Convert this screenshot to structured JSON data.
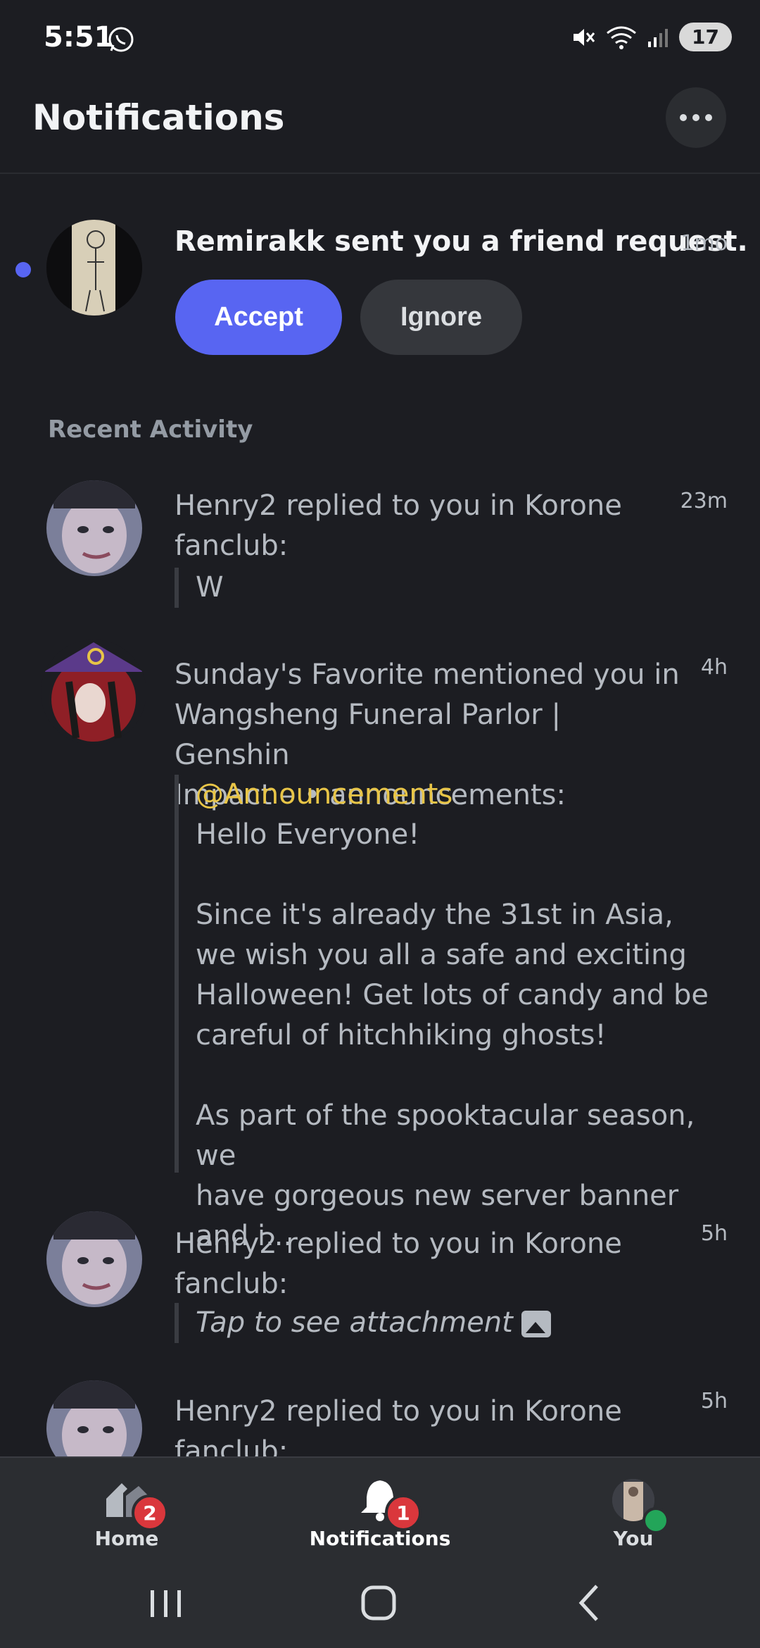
{
  "status_bar": {
    "time": "5:51",
    "battery_level": "17"
  },
  "header": {
    "title": "Notifications"
  },
  "friend_request": {
    "text": "Remirakk sent you a friend request.",
    "time": "1mo",
    "accept_label": "Accept",
    "ignore_label": "Ignore"
  },
  "section": {
    "recent_activity": "Recent Activity"
  },
  "activity": [
    {
      "line1": "Henry2 replied to you in Korone",
      "line2": "fanclub:",
      "time": "23m",
      "quote": "W"
    },
    {
      "line1": "Sunday's Favorite mentioned you in",
      "line2": "Wangsheng Funeral Parlor | Genshin",
      "line3": "Impact –  • announcements:",
      "time": "4h",
      "mention": "@Announcements",
      "q1": "Hello Everyone!",
      "q2": "Since it's already the 31st in Asia,",
      "q3": "we wish you all a safe and exciting",
      "q4": "Halloween! Get lots of candy and be",
      "q5": "careful of hitchhiking ghosts!",
      "q6": "As part of the spooktacular season, we",
      "q7": "have gorgeous new server banner and i..."
    },
    {
      "line1": "Henry2 replied to you in Korone",
      "line2": "fanclub:",
      "time": "5h",
      "quote": "Tap to see attachment"
    },
    {
      "line1": "Henry2 replied to you in Korone",
      "line2": "fanclub:",
      "time": "5h"
    }
  ],
  "bottom_nav": {
    "home_label": "Home",
    "home_badge": "2",
    "notifications_label": "Notifications",
    "notifications_badge": "1",
    "you_label": "You"
  },
  "colors": {
    "accent": "#5865f2",
    "background": "#1c1d22",
    "mention": "#e8c547",
    "badge": "#da373c",
    "online": "#23a559"
  },
  "icons": [
    "whatsapp-icon",
    "mute-icon",
    "wifi-icon",
    "signal-icon",
    "more-icon",
    "image-icon",
    "home-icon",
    "bell-icon",
    "recents-icon",
    "home-circle-icon",
    "back-icon"
  ]
}
